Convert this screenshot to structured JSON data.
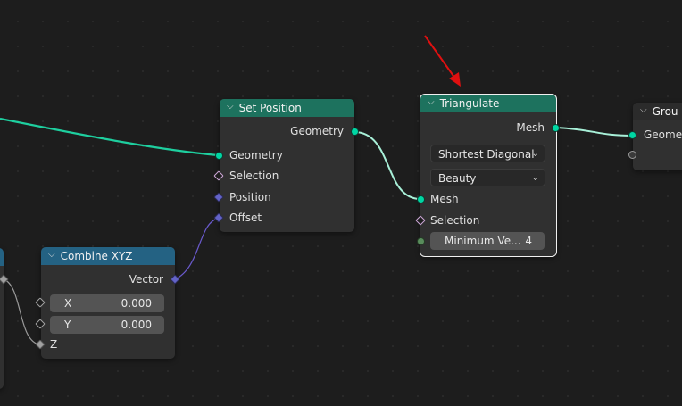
{
  "colors": {
    "background": "#1d1d1d",
    "node_body": "#303030",
    "geometry_header": "#1d725e",
    "input_header": "#246283",
    "geometry_socket": "#00d6a3",
    "vector_socket": "#6363c7",
    "bool_socket": "#cca6d6",
    "int_socket": "#598c5c",
    "annotation_arrow": "#e01010"
  },
  "set_position": {
    "title": "Set Position",
    "output_geometry": "Geometry",
    "inputs": [
      "Geometry",
      "Selection",
      "Position",
      "Offset"
    ]
  },
  "triangulate": {
    "title": "Triangulate",
    "output_mesh": "Mesh",
    "quad_method": "Shortest Diagonal",
    "ngon_method": "Beauty",
    "inputs": [
      "Mesh",
      "Selection"
    ],
    "min_vertices_label": "Minimum Ve...",
    "min_vertices_value": "4"
  },
  "combine_xyz": {
    "title": "Combine XYZ",
    "output_vector": "Vector",
    "x_label": "X",
    "x_value": "0.000",
    "y_label": "Y",
    "y_value": "0.000",
    "z_label": "Z"
  },
  "group_output": {
    "title": "Grou",
    "input_geometry": "Geomet"
  },
  "icons": {
    "collapse": "chevron-down-icon",
    "dropdown": "chevron-down-icon",
    "annotation": "red-arrow-annotation"
  }
}
